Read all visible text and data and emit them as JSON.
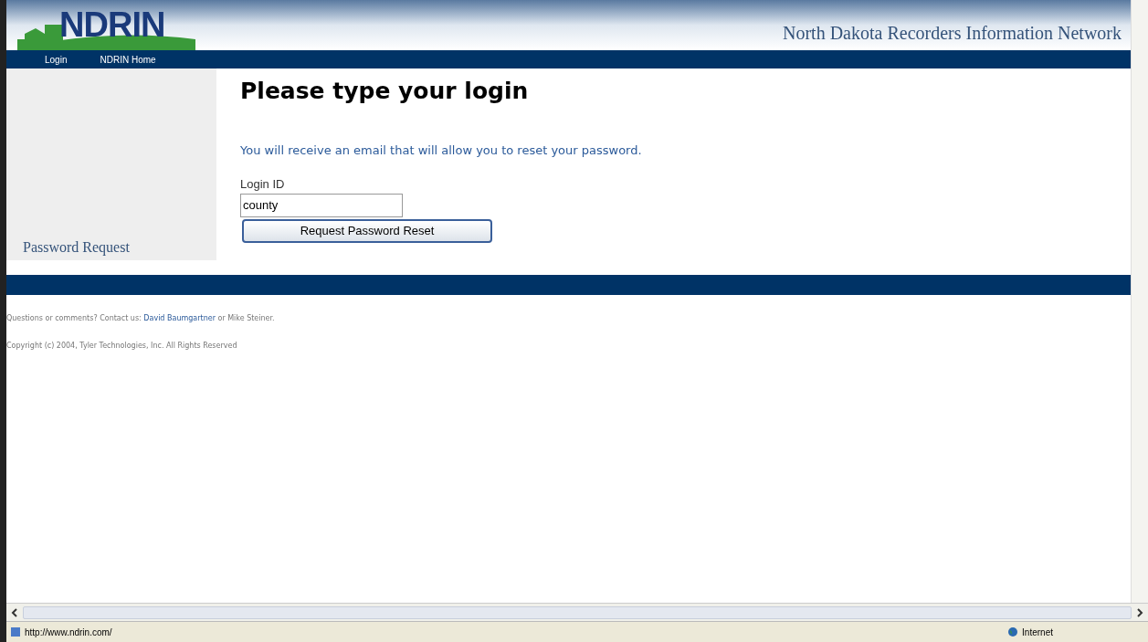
{
  "header": {
    "logo": "NDRIN",
    "tagline": "North Dakota Recorders Information Network"
  },
  "nav": [
    {
      "label": "Login"
    },
    {
      "label": "NDRIN Home"
    }
  ],
  "sidebar": {
    "label": "Password Request"
  },
  "main": {
    "heading": "Please type your login",
    "info": "You will receive an email that will allow you to reset your password.",
    "field": {
      "label": "Login ID",
      "value": "county"
    },
    "button": "Request Password Reset"
  },
  "footer": {
    "contact_prefix": "Questions or comments? Contact us:",
    "contact_link": "David Baumgartner",
    "contact_suffix": "or Mike Steiner.",
    "copyright": "Copyright (c) 2004, Tyler Technologies, Inc. All Rights Reserved"
  },
  "status_bar": {
    "url": "http://www.ndrin.com/",
    "zone": "Internet"
  }
}
